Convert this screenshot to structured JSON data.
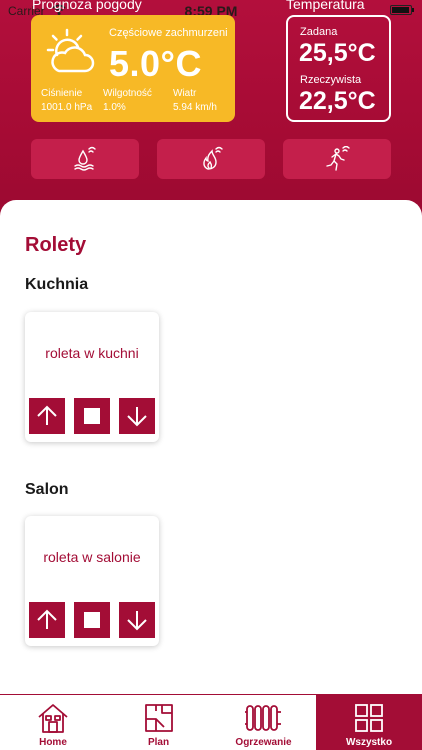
{
  "status_bar": {
    "carrier": "Carrier",
    "time": "8:59 PM"
  },
  "weather": {
    "section_label": "Prognoza pogody",
    "description": "Częściowe zachmurzeni",
    "temperature": "5.0°C",
    "pressure_label": "Ciśnienie",
    "pressure_value": "1001.0 hPa",
    "humidity_label": "Wilgotność",
    "humidity_value": "1.0%",
    "wind_label": "Wiatr",
    "wind_value": "5.94 km/h",
    "icon": "partly-cloudy-icon",
    "card_color": "#f7b926"
  },
  "temperature": {
    "section_label": "Temperatura",
    "set_label": "Zadana",
    "set_value": "25,5°C",
    "actual_label": "Rzeczywista",
    "actual_value": "22,5°C"
  },
  "quick_actions": [
    {
      "icon": "water-heating-icon"
    },
    {
      "icon": "flame-icon"
    },
    {
      "icon": "motion-sensor-icon"
    }
  ],
  "blinds": {
    "title": "Rolety",
    "rooms": [
      {
        "name": "Kuchnia",
        "blind": "roleta w kuchni"
      },
      {
        "name": "Salon",
        "blind": "roleta w salonie"
      }
    ]
  },
  "tabbar": {
    "items": [
      {
        "label": "Home",
        "icon": "home-icon"
      },
      {
        "label": "Plan",
        "icon": "floor-plan-icon"
      },
      {
        "label": "Ogrzewanie",
        "icon": "radiator-icon"
      },
      {
        "label": "Wszystko",
        "icon": "grid-icon",
        "active": true
      }
    ]
  },
  "colors": {
    "brand": "#a30d36",
    "header": "#b30f3c",
    "accent_yellow": "#f7b926"
  }
}
